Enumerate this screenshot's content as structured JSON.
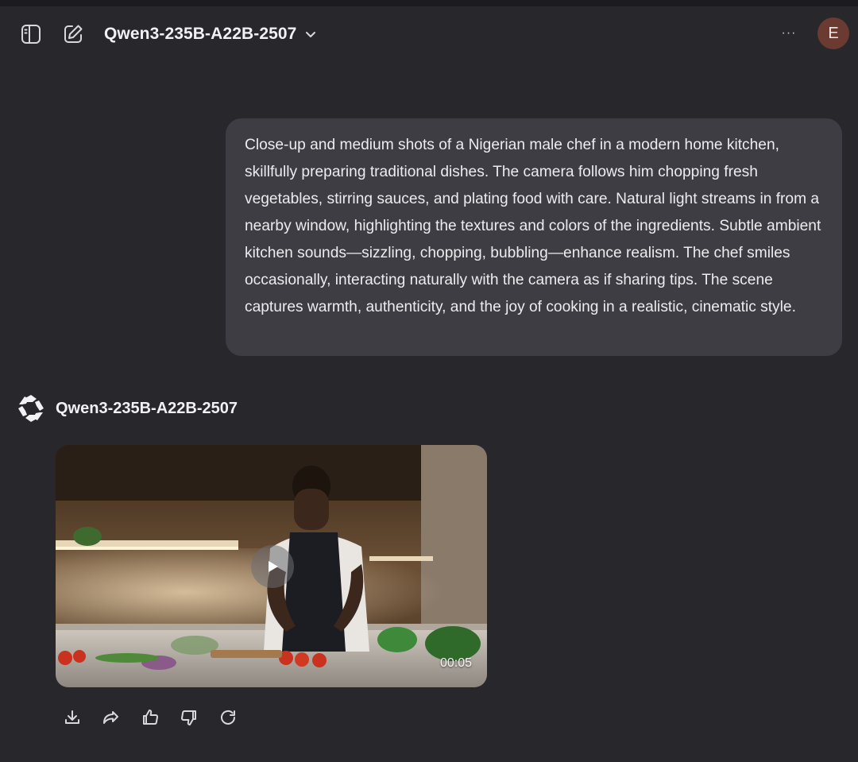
{
  "header": {
    "model_name": "Qwen3-235B-A22B-2507",
    "more_label": "···",
    "avatar_initial": "E"
  },
  "conversation": {
    "user_message": "Close-up and medium shots of a Nigerian male chef in a modern home kitchen, skillfully preparing traditional dishes. The camera follows him chopping fresh vegetables, stirring sauces, and plating food with care. Natural light streams in from a nearby window, highlighting the textures and colors of the ingredients. Subtle ambient kitchen sounds—sizzling, chopping, bubbling—enhance realism. The chef smiles occasionally, interacting naturally with the camera as if sharing tips. The scene captures warmth, authenticity, and the joy of cooking in a realistic, cinematic style.",
    "assistant_name": "Qwen3-235B-A22B-2507",
    "video": {
      "duration": "00:05"
    }
  },
  "actions": [
    "download-icon",
    "share-icon",
    "thumbs-up-icon",
    "thumbs-down-icon",
    "regenerate-icon"
  ],
  "colors": {
    "background": "#28272c",
    "bubble": "#3e3d44",
    "avatar": "#6b3a30"
  }
}
